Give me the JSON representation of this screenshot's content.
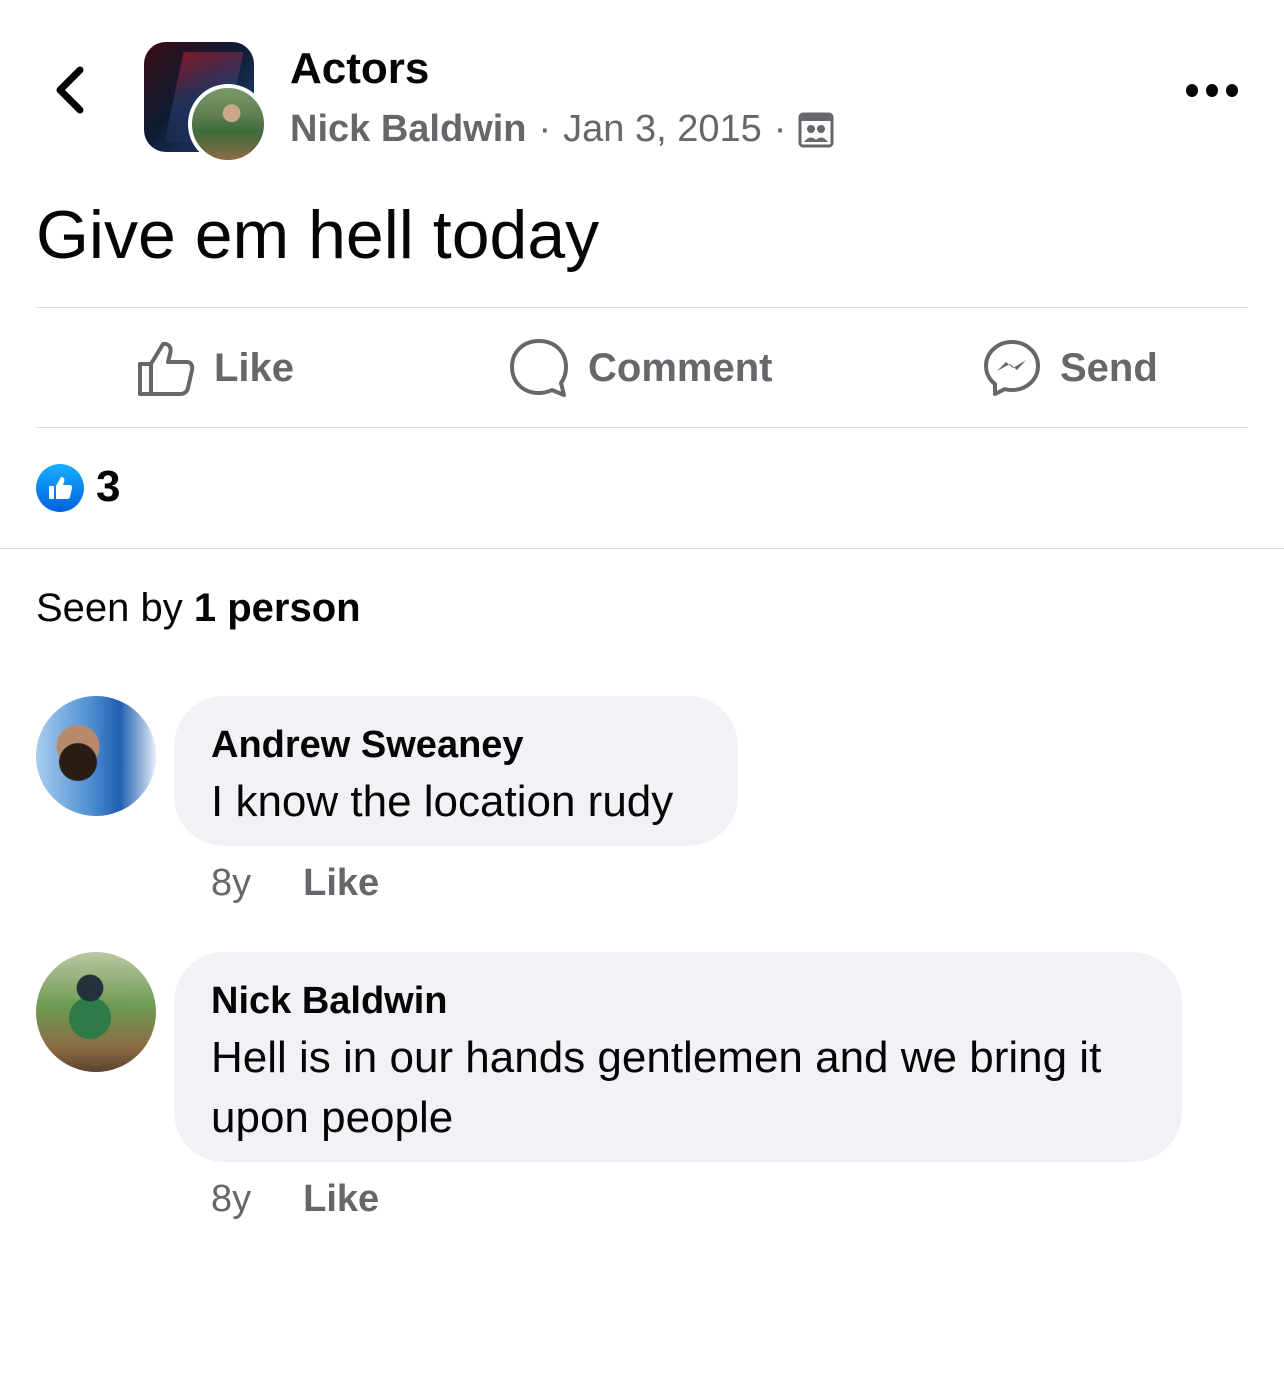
{
  "header": {
    "group_name": "Actors",
    "author": "Nick Baldwin",
    "separator": "·",
    "date": "Jan 3, 2015",
    "audience_icon": "group-audience-icon",
    "back_icon": "chevron-left-icon",
    "more_icon": "more-dots-icon"
  },
  "post": {
    "text": "Give em hell today"
  },
  "actions": {
    "like": "Like",
    "comment": "Comment",
    "send": "Send"
  },
  "reactions": {
    "count": "3",
    "icon": "like-reaction-icon",
    "color": "#1877f2"
  },
  "seen": {
    "prefix": "Seen by ",
    "count_text": "1 person"
  },
  "comments": [
    {
      "author": "Andrew Sweaney",
      "text": "I know the location rudy",
      "age": "8y",
      "like_label": "Like"
    },
    {
      "author": "Nick Baldwin",
      "text": "Hell is in our hands gentlemen and we bring it upon people",
      "age": "8y",
      "like_label": "Like"
    }
  ],
  "colors": {
    "secondary_text": "#65676b",
    "bubble_bg": "#f0f2f5",
    "divider": "#dadde1"
  }
}
